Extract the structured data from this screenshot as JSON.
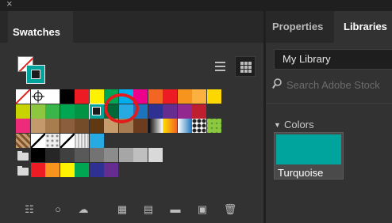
{
  "swatches_panel": {
    "close_glyph": "×",
    "collapse_glyph": "‹‹",
    "title": "Swatches",
    "menu_icon": "hamburger-menu-icon",
    "fill_color": "none",
    "stroke_color": "#00a49d",
    "selected_swatch": "#00a49d",
    "rows": [
      [
        "none",
        "registration",
        "#ffffff",
        "#000000",
        "#ed1c24",
        "#fff200",
        "#00a651",
        "#00aeef",
        "#ec008c",
        "#f26522",
        "#ed1c24",
        "#f7941d",
        "#fbb040",
        "#fdd800"
      ],
      [
        "#c8d400",
        "#8dc63f",
        "#39b54a",
        "#00a651",
        "#009444",
        "#00a49d",
        "#006838",
        "#27aae1",
        "#1c75bc",
        "#2e3192",
        "#662d91",
        "#92278f",
        "#be1e2d"
      ],
      [
        "#ee2a7b",
        "#c49a6c",
        "#a97c50",
        "#8b5e3c",
        "#754c29",
        "#603913",
        "#c69c6d",
        "#a67c52",
        "#6b3c1e",
        "gradient-bw",
        "gradient-orange",
        "gradient-blue",
        "pattern-dots",
        "pattern-green"
      ],
      [
        "pattern-brown",
        "pattern-slash",
        "pattern-dots-gray",
        "pattern-lines",
        "pattern-gray",
        "#27aae1"
      ],
      [
        "folder",
        "#000000",
        "#262626",
        "#404040",
        "#595959",
        "#737373",
        "#8c8c8c",
        "#a6a6a6",
        "#bfbfbf",
        "#d9d9d9"
      ],
      [
        "folder",
        "#ed1c24",
        "#f7941d",
        "#fff200",
        "#00a651",
        "#2e3192",
        "#662d91"
      ]
    ],
    "toolbar_icons": [
      "swatch-libraries-icon",
      "color-group-icon",
      "cloud-library-icon",
      "swatch-kind-icon",
      "swatch-options-icon",
      "new-color-group-icon",
      "new-swatch-icon",
      "delete-swatch-icon"
    ]
  },
  "libraries_panel": {
    "tab_properties": "Properties",
    "tab_libraries": "Libraries",
    "library_name": "My Library",
    "search_placeholder": "Search Adobe Stock",
    "colors_label": "Colors",
    "color_card": {
      "name": "Turquoise",
      "color": "#00a49d"
    }
  }
}
